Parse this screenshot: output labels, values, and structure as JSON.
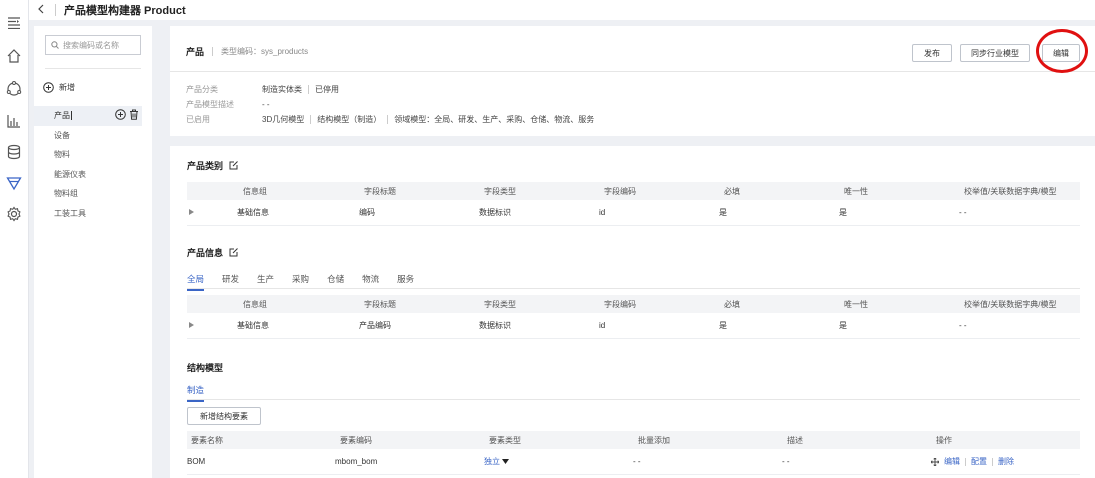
{
  "page": {
    "back_icon": "chevron-left-icon",
    "title": "产品模型构建器 Product"
  },
  "rail_icons": [
    "menu-icon",
    "home-icon",
    "cycle-icon",
    "chart-icon",
    "database-icon",
    "funnel-icon",
    "gear-icon"
  ],
  "sidebar": {
    "search_placeholder": "搜索编码或名称",
    "add_label": "新增",
    "items": [
      "产品",
      "设备",
      "物料",
      "能源仪表",
      "物料组",
      "工装工具"
    ]
  },
  "header": {
    "title": "产品",
    "type_code": "类型编码：sys_products",
    "publish": "发布",
    "sync": "同步行业模型",
    "edit": "编辑"
  },
  "info": {
    "category_label": "产品分类",
    "category_value": "制造实体类",
    "category_status": "已停用",
    "desc_label": "产品模型描述",
    "desc_value": "- -",
    "enabled_label": "已启用",
    "enabled_1": "3D几何模型",
    "enabled_2": "结构模型（制造）",
    "enabled_3": "领域模型：全局、研发、生产、采购、仓储、物流、服务"
  },
  "table_headers": [
    "信息组",
    "字段标题",
    "字段类型",
    "字段编码",
    "必填",
    "唯一性",
    "校举值/关联数据字典/模型"
  ],
  "category_section": {
    "title": "产品类别",
    "row": [
      "基础信息",
      "编码",
      "数据标识",
      "id",
      "是",
      "是",
      "- -"
    ]
  },
  "info_section": {
    "title": "产品信息",
    "tabs": [
      "全局",
      "研发",
      "生产",
      "采购",
      "仓储",
      "物流",
      "服务"
    ],
    "row": [
      "基础信息",
      "产品编码",
      "数据标识",
      "id",
      "是",
      "是",
      "- -"
    ]
  },
  "structure_section": {
    "title": "结构模型",
    "tab": "制造",
    "add_button": "新增结构要素",
    "headers": [
      "要素名称",
      "要素编码",
      "要素类型",
      "批量添加",
      "描述",
      "操作"
    ],
    "row": {
      "name": "BOM",
      "code": "mbom_bom",
      "type": "独立",
      "batch": "- -",
      "desc": "- -",
      "actions": [
        "编辑",
        "配置",
        "删除"
      ]
    }
  },
  "colors": {
    "accent": "#3a65c6",
    "highlight": "#e01010"
  }
}
